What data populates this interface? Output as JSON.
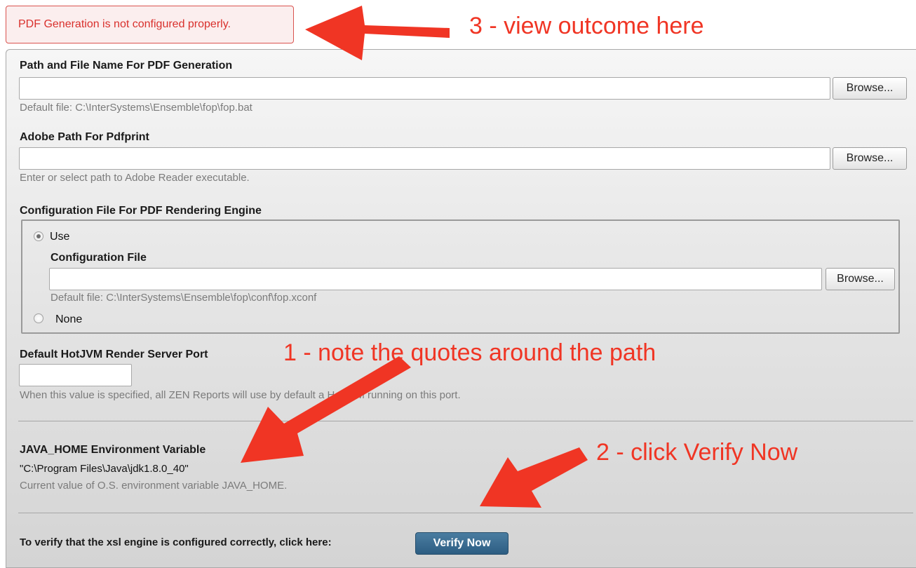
{
  "error": {
    "message": "PDF Generation is not configured properly."
  },
  "pdf_path": {
    "label": "Path and File Name For PDF Generation",
    "value": "",
    "browse_label": "Browse...",
    "hint": "Default file: C:\\InterSystems\\Ensemble\\fop\\fop.bat"
  },
  "adobe_path": {
    "label": "Adobe Path For Pdfprint",
    "value": "",
    "browse_label": "Browse...",
    "hint": "Enter or select path to Adobe Reader executable."
  },
  "config_file": {
    "group_label": "Configuration File For PDF Rendering Engine",
    "use_label": "Use",
    "field_label": "Configuration File",
    "value": "",
    "browse_label": "Browse...",
    "hint": "Default file: C:\\InterSystems\\Ensemble\\fop\\conf\\fop.xconf",
    "none_label": "None",
    "selected": "Use"
  },
  "hotjvm": {
    "label": "Default HotJVM Render Server Port",
    "value": "",
    "hint": "When this value is specified, all ZEN Reports will use by default a HotJVM running on this port."
  },
  "java_home": {
    "label": "JAVA_HOME Environment Variable",
    "value": "\"C:\\Program Files\\Java\\jdk1.8.0_40\"",
    "hint": "Current value of O.S. environment variable JAVA_HOME."
  },
  "verify": {
    "prompt": "To verify that the xsl engine is configured correctly, click here:",
    "button_label": "Verify Now"
  },
  "annotations": {
    "note1": "1 - note the quotes around the path",
    "note2": "2 - click Verify Now",
    "note3": "3 - view outcome here",
    "arrow_color": "#f03524"
  }
}
